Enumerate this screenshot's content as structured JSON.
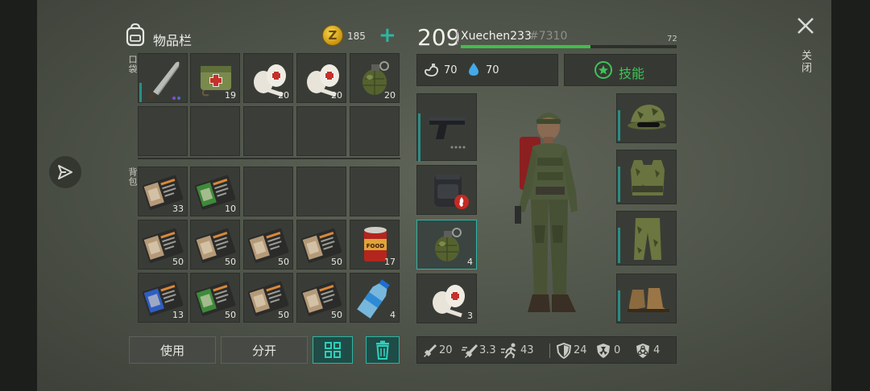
{
  "inventory": {
    "title": "物品栏",
    "coin_symbol": "Z",
    "coins": "185",
    "add_symbol": "+",
    "pocket_label": "口袋",
    "backpack_label": "背包",
    "pocket_slots": [
      {
        "item": "machete",
        "qty": ""
      },
      {
        "item": "first-aid-bag",
        "qty": "19"
      },
      {
        "item": "bandage-roll",
        "qty": "20"
      },
      {
        "item": "bandage-roll",
        "qty": "20"
      },
      {
        "item": "frag-grenade",
        "qty": "20"
      }
    ],
    "backpack_slots": [
      {
        "item": "blueprint-folder-tan",
        "qty": "33"
      },
      {
        "item": "blueprint-folder-green",
        "qty": "10"
      },
      {
        "item": "",
        "qty": ""
      },
      {
        "item": "",
        "qty": ""
      },
      {
        "item": "",
        "qty": ""
      },
      {
        "item": "blueprint-folder-tan",
        "qty": "50"
      },
      {
        "item": "blueprint-folder-tan",
        "qty": "50"
      },
      {
        "item": "blueprint-folder-tan",
        "qty": "50"
      },
      {
        "item": "blueprint-folder-tan",
        "qty": "50"
      },
      {
        "item": "canned-food",
        "qty": "17"
      },
      {
        "item": "blueprint-folder-blue",
        "qty": "13"
      },
      {
        "item": "blueprint-folder-green",
        "qty": "50"
      },
      {
        "item": "blueprint-folder-tan",
        "qty": "50"
      },
      {
        "item": "blueprint-folder-tan",
        "qty": "50"
      },
      {
        "item": "water-bottle",
        "qty": "4"
      }
    ],
    "can_label": "FOOD",
    "use_label": "使用",
    "split_label": "分开"
  },
  "character": {
    "level": "209",
    "name": "Xuechen233",
    "tag": "#7310",
    "xp_label": "72",
    "xp_fraction": 0.6,
    "hunger": "70",
    "thirst": "70",
    "skills_label": "技能",
    "equipment_left": [
      {
        "slot": "weapon",
        "item": "pistol",
        "qty": ""
      },
      {
        "slot": "backpack",
        "item": "tactical-backpack",
        "qty": ""
      },
      {
        "slot": "quick-1",
        "item": "frag-grenade",
        "qty": "4"
      },
      {
        "slot": "quick-2",
        "item": "bandage-roll",
        "qty": "3"
      }
    ],
    "equipment_right": [
      {
        "slot": "head",
        "item": "camo-cap"
      },
      {
        "slot": "body",
        "item": "camo-vest"
      },
      {
        "slot": "legs",
        "item": "camo-pants"
      },
      {
        "slot": "feet",
        "item": "boots"
      }
    ],
    "stats": {
      "damage": "20",
      "attack_speed": "3.3",
      "move_speed": "43",
      "armor": "24",
      "radiation": "0",
      "biohazard": "4"
    }
  },
  "close_label": "关闭",
  "colors": {
    "accent": "#2cb5a5",
    "xp": "#3fbf4a",
    "skill": "#3ec35a",
    "background": "#4d5248"
  }
}
